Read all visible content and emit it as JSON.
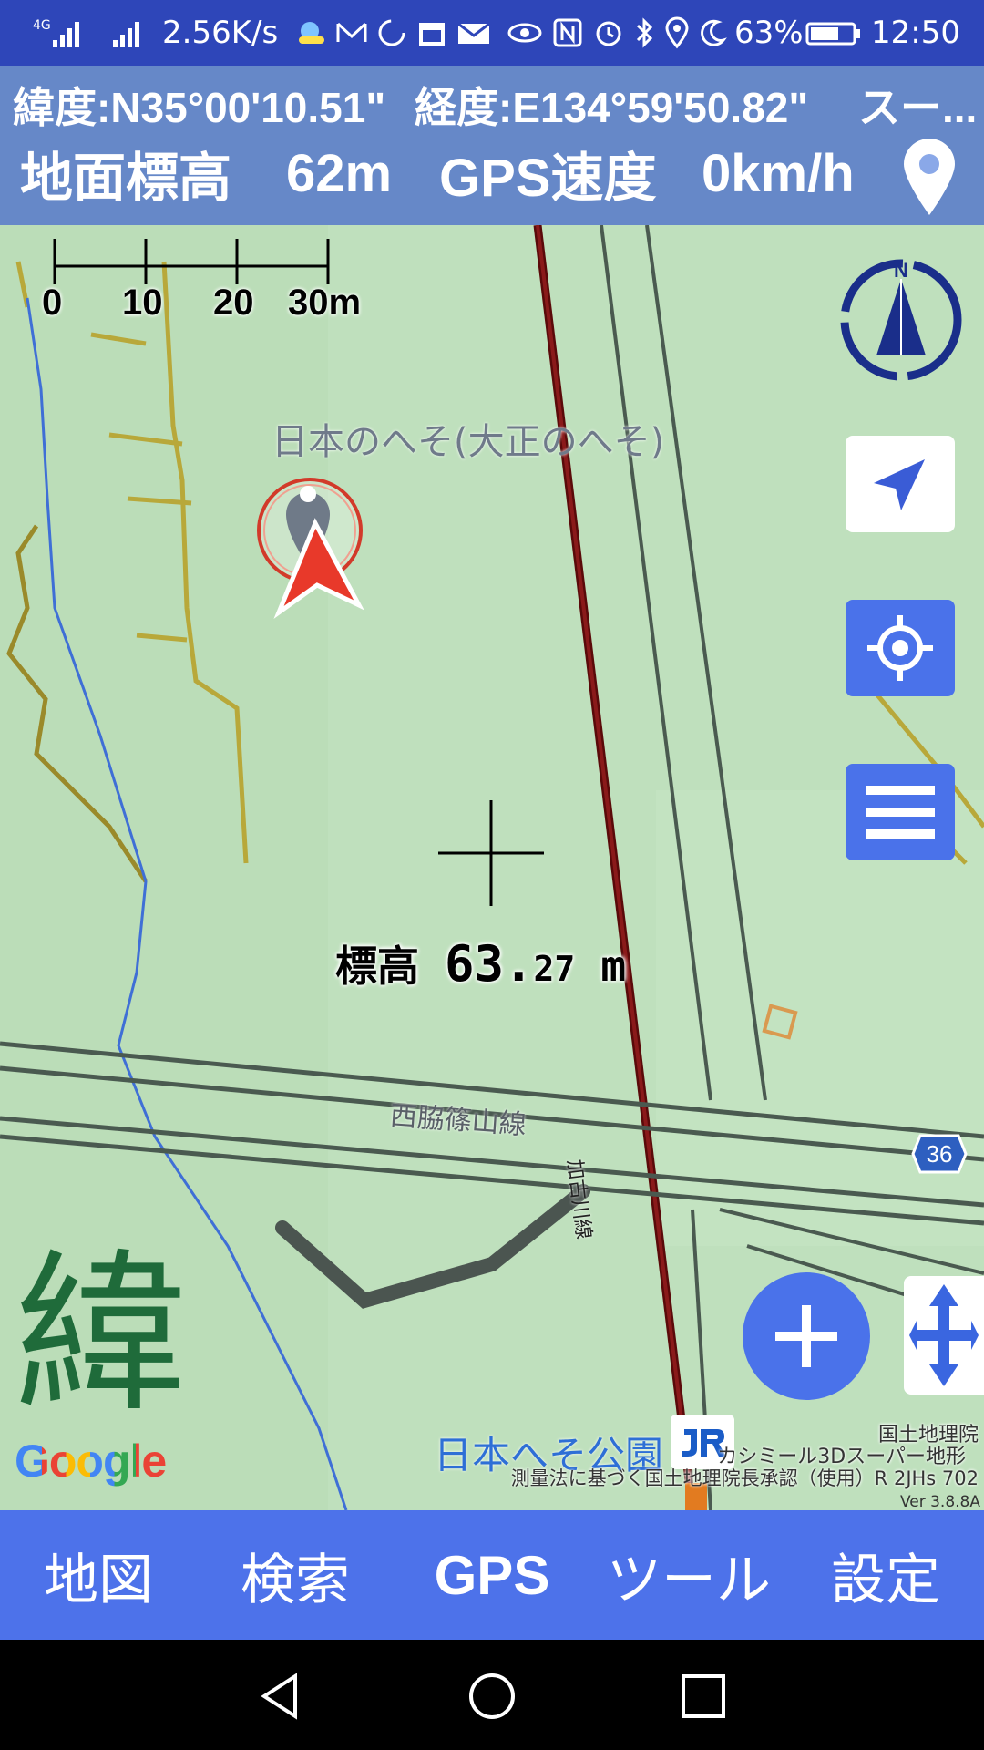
{
  "status_bar": {
    "network": "4G",
    "speed": "2.56K/s",
    "battery": "63%",
    "time": "12:50",
    "icons": [
      "signal-icon",
      "signal-icon",
      "weather-icon",
      "mail-icon",
      "sync-icon",
      "calendar-icon",
      "envelope-icon",
      "eye-icon",
      "nfc-icon",
      "alarm-icon",
      "bluetooth-icon",
      "location-icon",
      "moon-icon",
      "battery-icon"
    ]
  },
  "header": {
    "latitude": "緯度:N35°00'10.51\"",
    "longitude": "経度:E134°59'50.82\"",
    "extra": "スー...",
    "ground_elev_label": "地面標高",
    "ground_elev_value": "62m",
    "gps_speed_label": "GPS速度",
    "gps_speed_value": "0km/h"
  },
  "scale": {
    "ticks": [
      "0",
      "10",
      "20",
      "30m"
    ]
  },
  "map": {
    "place_name": "日本のへそ(大正のへそ)",
    "road_name": "西脇篠山線",
    "rail_name": "加古川線",
    "route_number": "36",
    "park_name": "日本へそ公園",
    "center_elev_label": "標高",
    "center_elev_int": "63.",
    "center_elev_dec": "27",
    "center_elev_unit": "m",
    "big_kanji": "緯",
    "google": "Google",
    "attribution_1": "国土地理院",
    "attribution_2": "カシミール3Dスーパー地形",
    "attribution_3": "測量法に基づく国土地理院長承認（使用）R 2JHs 702",
    "version": "Ver 3.8.8A",
    "compass_letter": "N"
  },
  "colors": {
    "status_bar": "#2e46b9",
    "nav_bar": "#4d72ea",
    "accent": "#4a72ea",
    "map_bg": "#bfe0bd",
    "railway": "#6b0a0a"
  },
  "bottom_nav": {
    "items": [
      "地図",
      "検索",
      "GPS",
      "ツール",
      "設定"
    ]
  }
}
